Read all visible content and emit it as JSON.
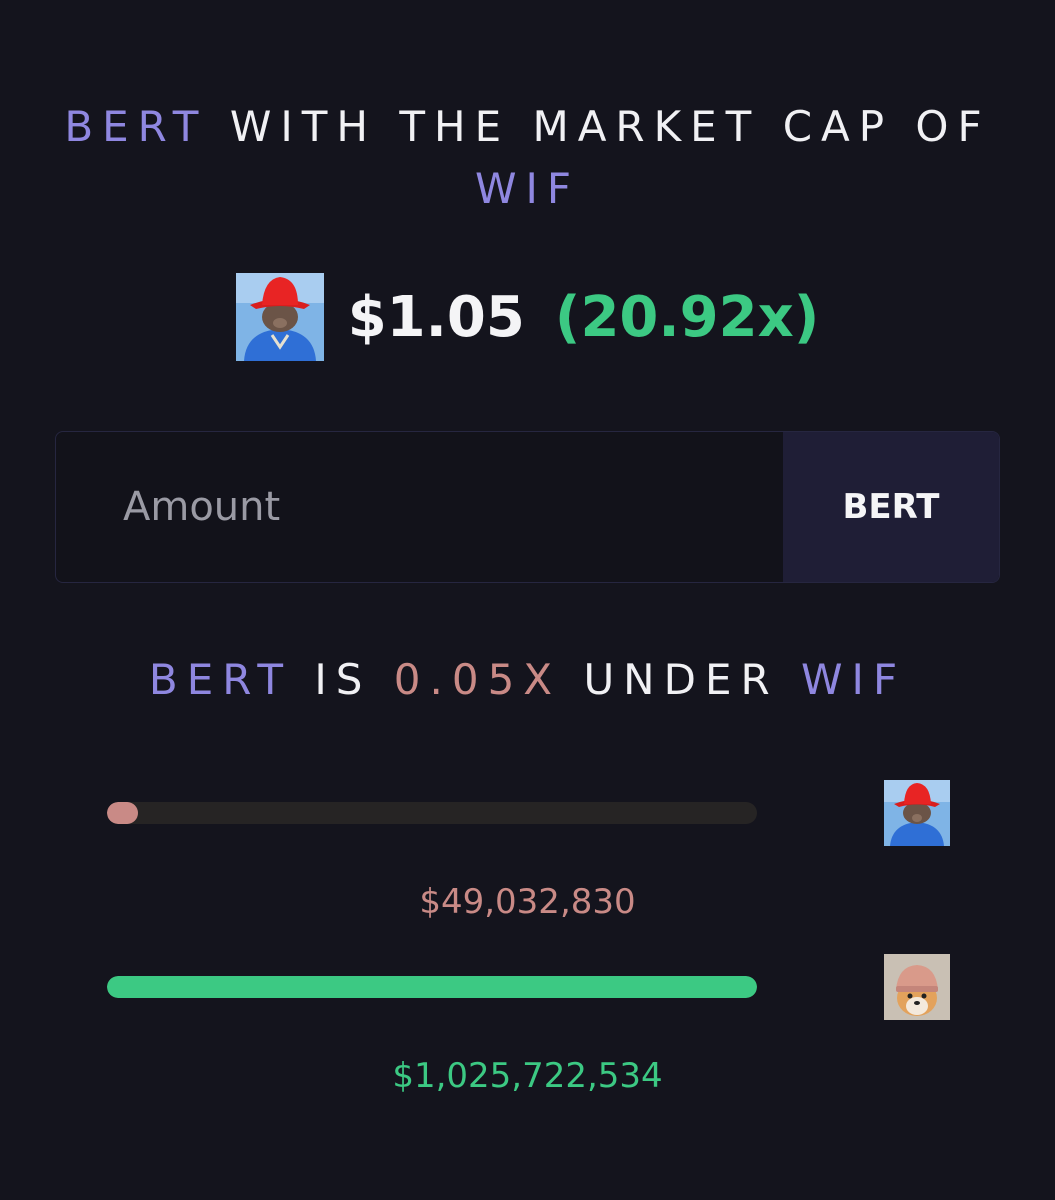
{
  "headline": {
    "token": "BERT",
    "middle": "WITH THE MARKET CAP OF",
    "target": "WIF"
  },
  "price": {
    "value": "$1.05",
    "multiple": "(20.92x)",
    "icon": "bert-avatar-icon"
  },
  "amount_input": {
    "placeholder": "Amount",
    "value": "",
    "token_label": "BERT"
  },
  "comparison": {
    "token": "BERT",
    "is": "IS",
    "ratio": "0.05X",
    "under": "UNDER",
    "target": "WIF"
  },
  "bars": [
    {
      "token": "BERT",
      "market_cap": "$49,032,830",
      "fill_fraction": 0.048,
      "color": "#c98a86",
      "icon": "bert-avatar-icon"
    },
    {
      "token": "WIF",
      "market_cap": "$1,025,722,534",
      "fill_fraction": 1.0,
      "color": "#3cc983",
      "icon": "wif-avatar-icon"
    }
  ],
  "colors": {
    "background": "#14141d",
    "accent": "#8f87e0",
    "positive": "#3cc983",
    "negative": "#c98a86"
  }
}
